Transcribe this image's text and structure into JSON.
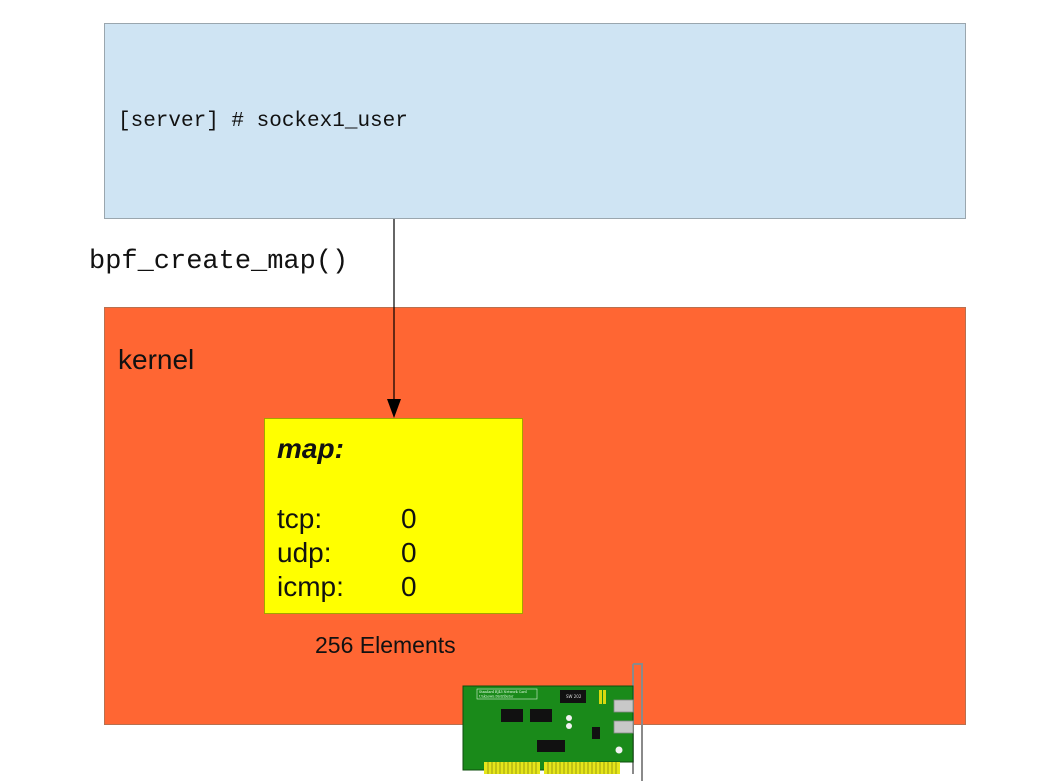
{
  "userspace": {
    "command": "[server] # sockex1_user"
  },
  "syscall_label": "bpf_create_map()",
  "kernel": {
    "label": "kernel"
  },
  "map": {
    "title": "map:",
    "entries": [
      {
        "key": "tcp:",
        "value": "0"
      },
      {
        "key": "udp:",
        "value": "0"
      },
      {
        "key": "icmp:",
        "value": "0"
      }
    ],
    "size_label": "256 Elements"
  },
  "nic": {
    "icon": "network-card-icon",
    "card_title": "Standard RJ45 Network Card",
    "card_subtitle": "Unknown Distributor",
    "chip_label": "SW 202"
  },
  "colors": {
    "userspace_bg": "#cfe4f3",
    "kernel_bg": "#ff6633",
    "map_bg": "#ffff00",
    "nic_board": "#1a8a1a",
    "nic_pins": "#e6e61a"
  }
}
